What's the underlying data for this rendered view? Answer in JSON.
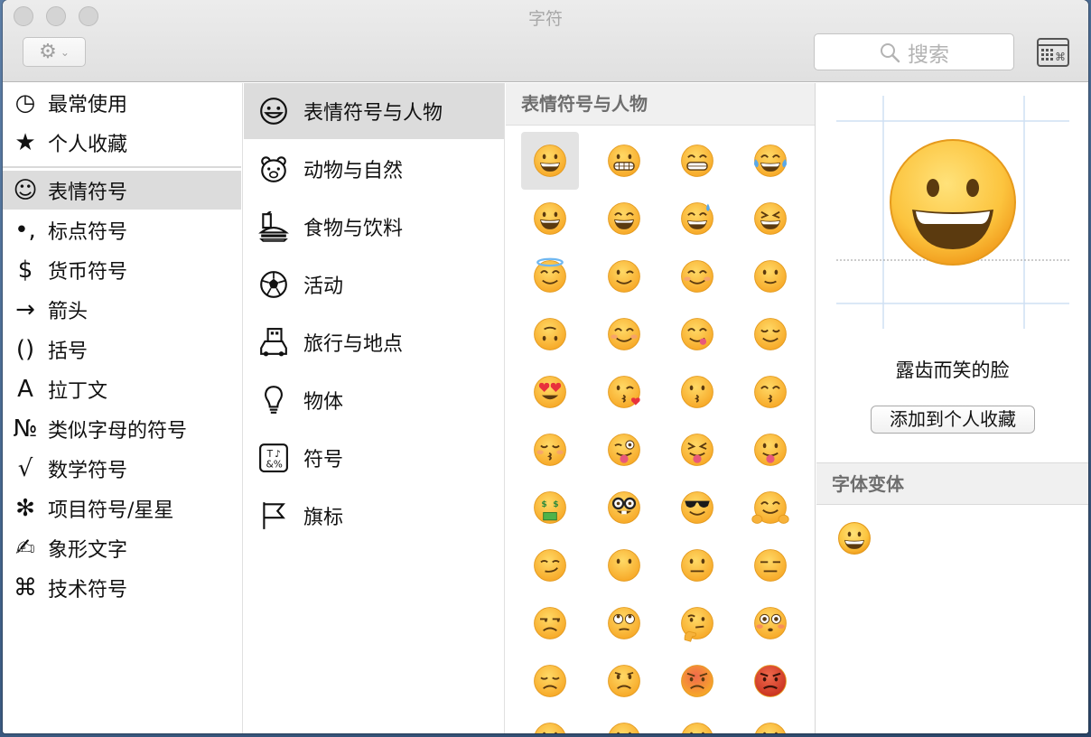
{
  "window": {
    "title": "字符"
  },
  "toolbar": {
    "search_placeholder": "搜索"
  },
  "sidebar1": {
    "items": [
      {
        "label": "最常使用",
        "icon": "clock-icon",
        "glyph": "◷"
      },
      {
        "label": "个人收藏",
        "icon": "star-icon",
        "glyph": "★"
      },
      {
        "label": "表情符号",
        "icon": "smiley-icon",
        "glyph": "☺"
      },
      {
        "label": "标点符号",
        "icon": "punctuation-icon",
        "glyph": "•,"
      },
      {
        "label": "货币符号",
        "icon": "dollar-icon",
        "glyph": "$"
      },
      {
        "label": "箭头",
        "icon": "arrow-icon",
        "glyph": "→"
      },
      {
        "label": "括号",
        "icon": "parentheses-icon",
        "glyph": "()"
      },
      {
        "label": "拉丁文",
        "icon": "latin-icon",
        "glyph": "A"
      },
      {
        "label": "类似字母的符号",
        "icon": "numero-icon",
        "glyph": "№"
      },
      {
        "label": "数学符号",
        "icon": "sqrt-icon",
        "glyph": "√"
      },
      {
        "label": "项目符号/星星",
        "icon": "asterisk-icon",
        "glyph": "✻"
      },
      {
        "label": "象形文字",
        "icon": "writing-hand-icon",
        "glyph": "✍"
      },
      {
        "label": "技术符号",
        "icon": "command-icon",
        "glyph": "⌘"
      }
    ],
    "selected_index": 2
  },
  "sidebar2": {
    "items": [
      {
        "label": "表情符号与人物",
        "icon": "smiley-outline-icon"
      },
      {
        "label": "动物与自然",
        "icon": "bear-icon"
      },
      {
        "label": "食物与饮料",
        "icon": "burger-drink-icon"
      },
      {
        "label": "活动",
        "icon": "soccer-ball-icon"
      },
      {
        "label": "旅行与地点",
        "icon": "car-building-icon"
      },
      {
        "label": "物体",
        "icon": "lightbulb-icon"
      },
      {
        "label": "符号",
        "icon": "symbols-icon"
      },
      {
        "label": "旗标",
        "icon": "flag-icon"
      }
    ],
    "selected_index": 0
  },
  "grid": {
    "header": "表情符号与人物",
    "selected_index": 0,
    "emojis": [
      {
        "name": "grinning-face",
        "kind": "smile-teeth"
      },
      {
        "name": "grimacing-face",
        "kind": "grimace"
      },
      {
        "name": "grinning-face-smiling-eyes",
        "kind": "grin-eyes"
      },
      {
        "name": "face-with-tears-of-joy",
        "kind": "tears-joy"
      },
      {
        "name": "smiling-face-open-mouth",
        "kind": "open-smile"
      },
      {
        "name": "smiling-face-open-mouth-smiling-eyes",
        "kind": "open-smile-eyes"
      },
      {
        "name": "smiling-face-open-mouth-cold-sweat",
        "kind": "sweat-smile"
      },
      {
        "name": "smiling-face-tightly-closed-eyes",
        "kind": "laughing"
      },
      {
        "name": "smiling-face-with-halo",
        "kind": "halo"
      },
      {
        "name": "winking-face",
        "kind": "wink"
      },
      {
        "name": "smiling-face-smiling-eyes",
        "kind": "blush"
      },
      {
        "name": "slightly-smiling-face",
        "kind": "slight-smile"
      },
      {
        "name": "upside-down-face",
        "kind": "upside-down"
      },
      {
        "name": "white-smiling-face",
        "kind": "relaxed"
      },
      {
        "name": "face-savouring-food",
        "kind": "yum"
      },
      {
        "name": "relieved-face",
        "kind": "relieved"
      },
      {
        "name": "heart-eyes-face",
        "kind": "heart-eyes"
      },
      {
        "name": "face-throwing-kiss",
        "kind": "kiss-heart"
      },
      {
        "name": "kissing-face",
        "kind": "kiss"
      },
      {
        "name": "kissing-face-smiling-eyes",
        "kind": "kiss-smile"
      },
      {
        "name": "kissing-face-closed-eyes",
        "kind": "kiss-closed"
      },
      {
        "name": "stuck-out-tongue-winking-eye",
        "kind": "tongue-wink"
      },
      {
        "name": "stuck-out-tongue-closed-eyes",
        "kind": "tongue-closed"
      },
      {
        "name": "face-with-stuck-out-tongue",
        "kind": "tongue"
      },
      {
        "name": "money-mouth-face",
        "kind": "money"
      },
      {
        "name": "nerd-face",
        "kind": "nerd"
      },
      {
        "name": "smiling-face-with-sunglasses",
        "kind": "sunglasses"
      },
      {
        "name": "hugging-face",
        "kind": "hug"
      },
      {
        "name": "smirking-face",
        "kind": "smirk"
      },
      {
        "name": "face-without-mouth",
        "kind": "no-mouth"
      },
      {
        "name": "neutral-face",
        "kind": "neutral"
      },
      {
        "name": "expressionless-face",
        "kind": "expressionless"
      },
      {
        "name": "unamused-face",
        "kind": "unamused"
      },
      {
        "name": "face-with-rolling-eyes",
        "kind": "rolling-eyes"
      },
      {
        "name": "thinking-face",
        "kind": "thinking"
      },
      {
        "name": "flushed-face",
        "kind": "flushed"
      },
      {
        "name": "disappointed-face",
        "kind": "disappointed"
      },
      {
        "name": "worried-face",
        "kind": "worried"
      },
      {
        "name": "angry-face",
        "kind": "angry"
      },
      {
        "name": "pouting-face",
        "kind": "pouting"
      },
      {
        "name": "partial-face-1",
        "kind": "partial"
      },
      {
        "name": "partial-face-2",
        "kind": "partial"
      },
      {
        "name": "partial-face-3",
        "kind": "partial"
      },
      {
        "name": "partial-face-4",
        "kind": "partial"
      }
    ]
  },
  "detail": {
    "character_name": "露齿而笑的脸",
    "add_favorite_label": "添加到个人收藏",
    "variants_header": "字体变体"
  },
  "colors": {
    "emoji_yellow_top": "#ffd966",
    "emoji_yellow_bottom": "#f7a928",
    "emoji_outline": "#e39a1e",
    "selection_gray": "#dcdcdc",
    "angry_red": "#e04a36"
  }
}
